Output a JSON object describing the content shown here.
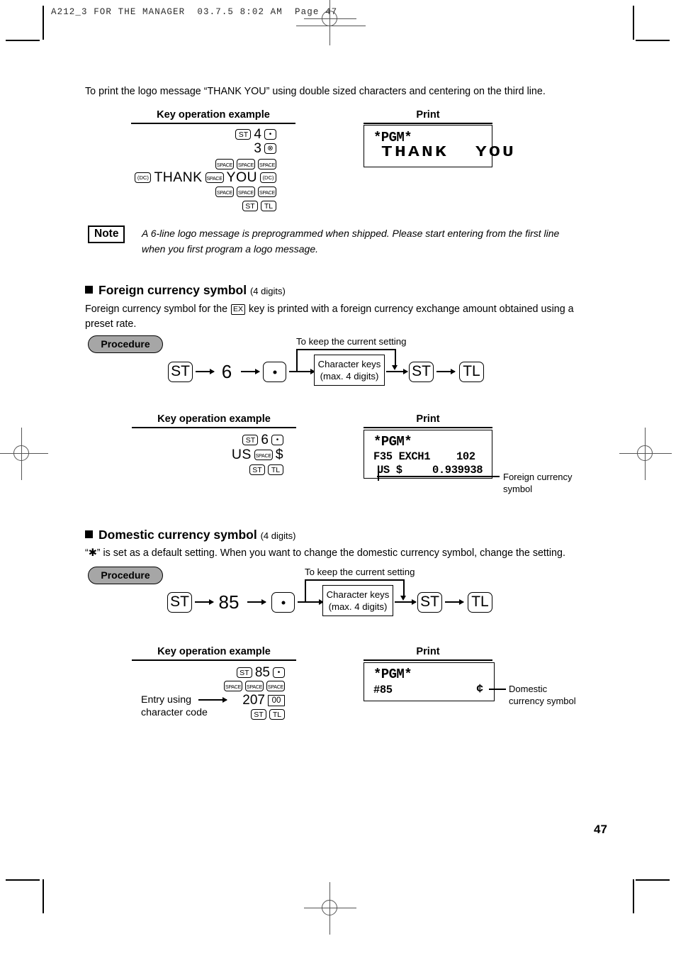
{
  "page": {
    "slug": "A212_3 FOR THE MANAGER  03.7.5 8:02 AM  Page 47",
    "number": "47"
  },
  "intro": {
    "text": "To print the logo message “THANK YOU” using double sized characters and centering on the third line."
  },
  "labels": {
    "key_operation_example": "Key operation example",
    "print": "Print",
    "procedure": "Procedure",
    "to_keep": "To keep the current setting",
    "character_keys_l1": "Character keys",
    "character_keys_l2": "(max. 4 digits)"
  },
  "keys": {
    "st": "ST",
    "tl": "TL",
    "dot": "•",
    "multiply": "⊗",
    "space": "SPACE",
    "dc": "(DC)",
    "ex": "EX",
    "zerozero": "00"
  },
  "logo_example": {
    "row1": {
      "num": "4"
    },
    "row2": {
      "num": "3"
    },
    "row4": {
      "word1": "THANK",
      "word2": "YOU"
    }
  },
  "logo_print": {
    "line1": "*PGM*",
    "line2": "THANK  YOU"
  },
  "note": {
    "badge": "Note",
    "line1": "A 6-line logo message is preprogrammed when shipped.  Please start entering from the first line",
    "line2": "when you first program a logo message."
  },
  "foreign": {
    "heading": "Foreign currency symbol",
    "heading_sub": "(4 digits)",
    "body_pre": "Foreign currency symbol for the ",
    "body_post": " key is printed with a foreign currency exchange amount obtained using a",
    "body_line2": "preset rate.",
    "procedure_num": "6",
    "example": {
      "row1_num": "6",
      "row2_us": "US",
      "row2_dollar": "$"
    },
    "print": {
      "line1": "*PGM*",
      "line2_left": "F35 EXCH1",
      "line2_right": "102",
      "line3_left": "US $",
      "line3_right": "0.939938"
    },
    "callout_l1": "Foreign currency",
    "callout_l2": "symbol"
  },
  "domestic": {
    "heading": "Domestic currency symbol",
    "heading_sub": "(4 digits)",
    "body": "“✱” is set as a default setting.  When you want to change the domestic currency symbol, change the setting.",
    "procedure_num": "85",
    "example": {
      "row1_num": "85",
      "row3_num": "207"
    },
    "entry_label_l1": "Entry using",
    "entry_label_l2": "character code",
    "print": {
      "line1": "*PGM*",
      "line2_left": "#85",
      "line2_right": "¢"
    },
    "callout_l1": "Domestic",
    "callout_l2": "currency symbol"
  }
}
